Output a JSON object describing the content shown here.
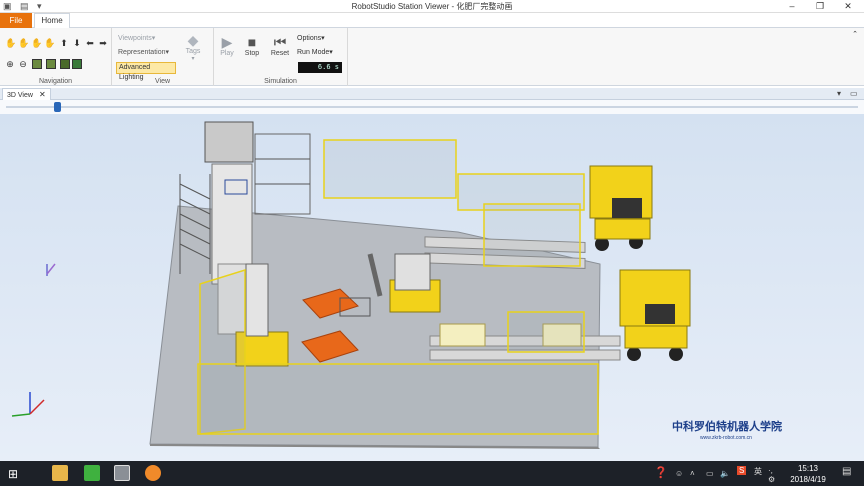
{
  "window": {
    "title": "RobotStudio Station Viewer - 化肥厂完整动画",
    "controls": {
      "minimize": "–",
      "maximize": "❐",
      "close": "✕"
    }
  },
  "ribbon": {
    "tabs": {
      "file": "File",
      "home": "Home"
    },
    "navigation": {
      "label": "Navigation"
    },
    "view": {
      "label": "View",
      "viewpoints": "Viewpoints",
      "representation": "Representation",
      "advanced_lighting": "Advanced Lighting",
      "tags": "Tags"
    },
    "simulation": {
      "label": "Simulation",
      "play": "Play",
      "stop": "Stop",
      "reset": "Reset",
      "options": "Options",
      "run_mode": "Run Mode",
      "timer": "6.6 s"
    }
  },
  "document": {
    "tab_label": "3D View",
    "tab_close": "✕",
    "timeline_progress": 0.06
  },
  "viewport": {
    "watermark_cn": "中科罗伯特机器人学院",
    "watermark_url": "www.zkrb-robot.com.cn"
  },
  "taskbar": {
    "ime": "英",
    "time": "15:13",
    "date": "2018/4/19"
  },
  "colors": {
    "file_tab": "#e8720c",
    "accent_blue": "#2a67b8",
    "fence_yellow": "#e8d21c",
    "forklift_yellow": "#f2d21a",
    "pallet_orange": "#e8681a"
  }
}
